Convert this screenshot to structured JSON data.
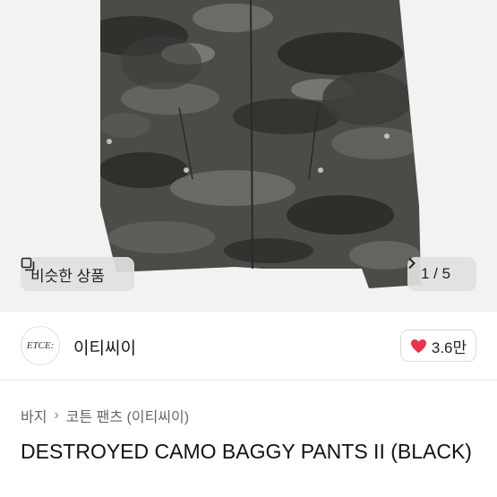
{
  "hero": {
    "similar_label": "비슷한 상품",
    "counter": "1 / 5"
  },
  "seller": {
    "logo_text": "ETCE:",
    "name": "이티씨이",
    "likes": "3.6만"
  },
  "breadcrumb": {
    "category": "바지",
    "subcategory": "코튼 팬츠 (이티씨이)"
  },
  "product": {
    "title": "DESTROYED CAMO BAGGY PANTS II (BLACK)"
  },
  "colors": {
    "heart": "#e8344e",
    "camo_base": "#4a4c47"
  }
}
